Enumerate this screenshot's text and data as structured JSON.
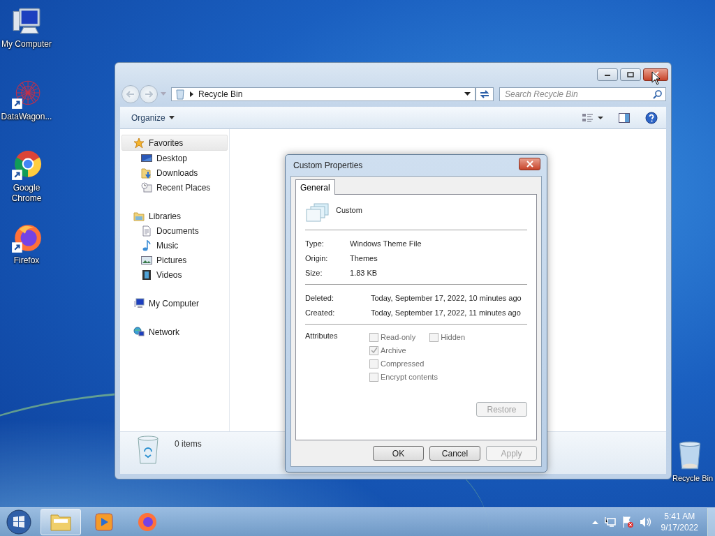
{
  "desktop_icons": [
    {
      "label": "My Computer",
      "kind": "computer",
      "shortcut": false
    },
    {
      "label": "DataWagon...",
      "kind": "datawagon",
      "shortcut": true
    },
    {
      "label": "Google Chrome",
      "kind": "chrome",
      "shortcut": true
    },
    {
      "label": "Firefox",
      "kind": "firefox",
      "shortcut": true
    },
    {
      "label": "Recycle Bin",
      "kind": "bin",
      "shortcut": false
    }
  ],
  "explorer": {
    "address": "Recycle Bin",
    "search": {
      "placeholder": "Search Recycle Bin"
    },
    "organize": "Organize",
    "nav": [
      {
        "label": "Favorites",
        "kind": "star",
        "selected": true,
        "children": [
          {
            "label": "Desktop",
            "kind": "desktop",
            "selected": false
          },
          {
            "label": "Downloads",
            "kind": "downloads",
            "selected": false
          },
          {
            "label": "Recent Places",
            "kind": "recent",
            "selected": false
          }
        ]
      },
      {
        "label": "Libraries",
        "kind": "library",
        "selected": false,
        "children": [
          {
            "label": "Documents",
            "kind": "document",
            "selected": false
          },
          {
            "label": "Music",
            "kind": "music",
            "selected": false
          },
          {
            "label": "Pictures",
            "kind": "pictures",
            "selected": false
          },
          {
            "label": "Videos",
            "kind": "videos",
            "selected": false
          }
        ]
      },
      {
        "label": "My Computer",
        "kind": "computer",
        "selected": false
      },
      {
        "label": "Network",
        "kind": "network",
        "selected": false
      }
    ],
    "status": "0 items"
  },
  "dialog": {
    "title": "Custom Properties",
    "tabs": [
      {
        "label": "General",
        "selected": true
      }
    ],
    "file_name": "Custom",
    "info": [
      {
        "label": "Type:",
        "value": "Windows Theme File"
      },
      {
        "label": "Origin:",
        "value": "Themes"
      },
      {
        "label": "Size:",
        "value": "1.83 KB"
      }
    ],
    "dates": [
      {
        "label": "Deleted:",
        "value": "Today, September 17, 2022, 10 minutes ago"
      },
      {
        "label": "Created:",
        "value": "Today, September 17, 2022, 11 minutes ago"
      }
    ],
    "attributes_label": "Attributes",
    "attributes": [
      {
        "label": "Read-only",
        "checked": false
      },
      {
        "label": "Hidden",
        "checked": false
      },
      {
        "label": "Archive",
        "checked": true
      },
      {
        "label": "Compressed",
        "checked": false
      },
      {
        "label": "Encrypt contents",
        "checked": false
      }
    ],
    "restore": {
      "label": "Restore",
      "disabled": true
    },
    "buttons": [
      {
        "label": "OK",
        "disabled": false
      },
      {
        "label": "Cancel",
        "disabled": false
      },
      {
        "label": "Apply",
        "disabled": true
      }
    ]
  },
  "taskbar": {
    "apps": [
      {
        "kind": "folder",
        "active": true
      },
      {
        "kind": "media",
        "active": false
      },
      {
        "kind": "firefox",
        "active": false
      }
    ],
    "time": "5:41 AM",
    "date": "9/17/2022"
  }
}
